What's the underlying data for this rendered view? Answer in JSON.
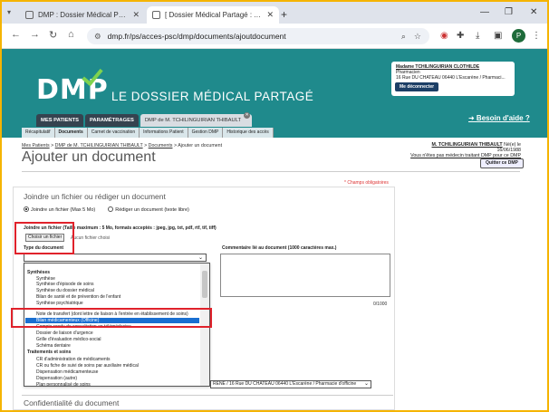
{
  "browser": {
    "tabs": [
      {
        "title": "DMP : Dossier Médical Partagé",
        "active": false
      },
      {
        "title": "[ Dossier Médical Partagé : Ajou",
        "active": true
      }
    ],
    "new_tab": "+",
    "url": "dmp.fr/ps/acces-psc/dmp/documents/ajoutdocument",
    "profile_initial": "P"
  },
  "header": {
    "logo": "DMP",
    "tagline": "LE DOSSIER MÉDICAL PARTAGÉ",
    "user": {
      "name": "Madame TCHILINGUIRIAN CLOTHILDE",
      "role": "Pharmacien",
      "address": "16 Rue DU CHATEAU 06440 L'Escarène / Pharmaci..."
    },
    "logout": "Me déconnecter",
    "help": "➜ Besoin d'aide ?"
  },
  "nav": {
    "tabs": [
      "MES PATIENTS",
      "PARAMÉTRAGES",
      "DMP de M. TCHILINGUIRIAN THIBAULT"
    ],
    "subtabs": [
      "Récapitulatif",
      "Documents",
      "Carnet de vaccination",
      "Informations Patient",
      "Gestion DMP",
      "Historique des accès"
    ]
  },
  "breadcrumb": {
    "items": [
      "Mes Patients",
      "DMP de M. TCHILINGUIRIAN THIBAULT",
      "Documents"
    ],
    "separator": " > ",
    "current": "> Ajouter un document"
  },
  "page_title": "Ajouter un document",
  "patient": {
    "name": "M. TCHILINGUIRIAN THIBAULT",
    "born": "Né(e) le 16/06/1988",
    "notice": "Vous n'êtes pas médecin traitant DMP pour ce DMP",
    "quit": "Quitter ce DMP"
  },
  "form": {
    "required_note": "* Champs obligatoires",
    "section_title": "Joindre un fichier ou rédiger un document",
    "radio_file": "Joindre un fichier (Max 5 Mo)",
    "radio_write": "Rédiger un document (texte libre)",
    "file_label": "Joindre un fichier (Taille maximum : 5 Mo, formats acceptés : jpeg, jpg, txt, pdf, rtf, tif, tiff)",
    "file_button": "Choisir un fichier",
    "file_none": "Aucun fichier choisi",
    "type_label": "Type du document",
    "comment_label": "Commentaire lié au document (1000 caractères max.)",
    "counter": "0/1000",
    "pharmacy_select": "RÈNE / 16 Rue DU CHATEAU 06440 L'Escarène / Pharmacie d'officine",
    "confid_title": "Confidentialité du document"
  },
  "dropdown": {
    "items": [
      {
        "label": "Synthèses",
        "kind": "group"
      },
      {
        "label": "Synthèse",
        "kind": "opt"
      },
      {
        "label": "Synthèse d'épisode de soins",
        "kind": "opt"
      },
      {
        "label": "Synthèse du dossier médical",
        "kind": "opt"
      },
      {
        "label": "Bilan de santé et de prévention de l'enfant",
        "kind": "opt"
      },
      {
        "label": "Synthèse psychiatrique",
        "kind": "opt"
      },
      {
        "label": "Note de transfert (dont lettre de liaison à l'entrée en établissement de soins)",
        "kind": "opt"
      },
      {
        "label": "Bilan médicamenteux (Officine)",
        "kind": "sel"
      },
      {
        "label": "Compte rendu de consultation en télémédecine",
        "kind": "opt"
      },
      {
        "label": "Dossier de liaison d'urgence",
        "kind": "opt"
      },
      {
        "label": "Grille d'évaluation médico-social",
        "kind": "opt"
      },
      {
        "label": "Schéma dentaire",
        "kind": "opt"
      },
      {
        "label": "Traitements et soins",
        "kind": "group"
      },
      {
        "label": "CR d'administration de médicaments",
        "kind": "opt"
      },
      {
        "label": "CR ou fiche de suivi de soins par auxiliaire médical",
        "kind": "opt"
      },
      {
        "label": "Dispensation médicamenteuse",
        "kind": "opt"
      },
      {
        "label": "Dispensation (autre)",
        "kind": "opt"
      },
      {
        "label": "Plan personnalisé de soins",
        "kind": "opt"
      }
    ]
  },
  "colors": {
    "header": "#1f8a8c",
    "accent_green": "#7fd34f",
    "highlight": "#e0222b",
    "selected": "#1a6fd1"
  }
}
